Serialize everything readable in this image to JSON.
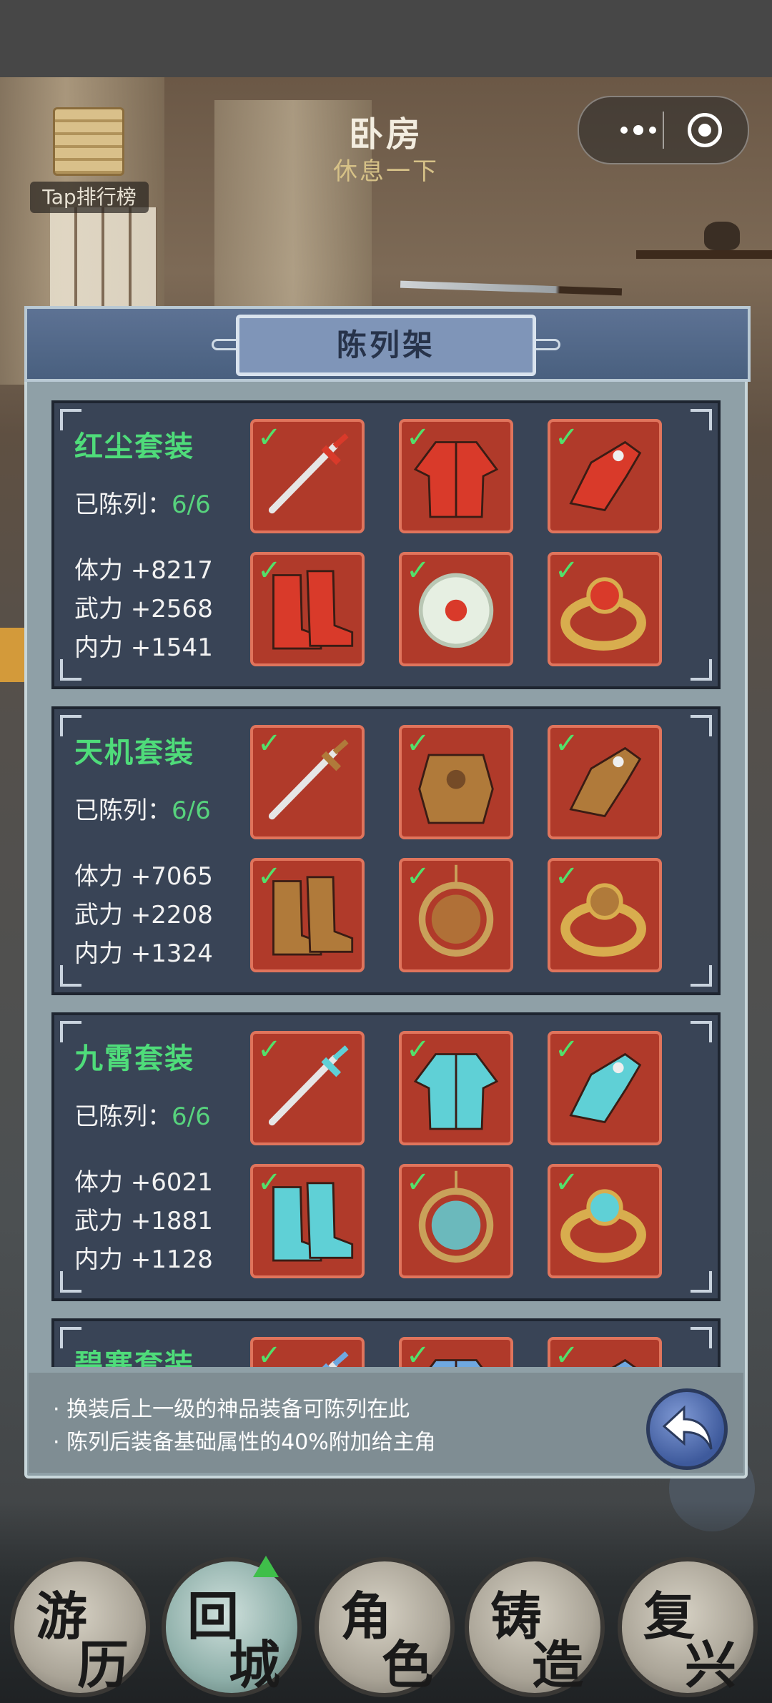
{
  "room": {
    "title": "卧房",
    "subtitle": "休息一下"
  },
  "rank": {
    "label": "Tap排行榜"
  },
  "capsule": {
    "menu_icon": "more-dots-icon",
    "close_icon": "target-icon"
  },
  "panel": {
    "title": "陈列架"
  },
  "suits": [
    {
      "name": "红尘套装",
      "count_label": "已陈列：",
      "count": "6/6",
      "stats": [
        "体力 +8217",
        "武力 +2568",
        "内力 +1541"
      ],
      "theme": "#d93a2a",
      "items": [
        "sword-icon",
        "robe-icon",
        "gauntlet-icon",
        "boots-icon",
        "jade-pendant-icon",
        "ring-icon"
      ]
    },
    {
      "name": "天机套装",
      "count_label": "已陈列：",
      "count": "6/6",
      "stats": [
        "体力 +7065",
        "武力 +2208",
        "内力 +1324"
      ],
      "theme": "#b07a3a",
      "items": [
        "sword-icon",
        "armor-icon",
        "gauntlet-icon",
        "boots-icon",
        "amulet-icon",
        "ring-icon"
      ]
    },
    {
      "name": "九霄套装",
      "count_label": "已陈列：",
      "count": "6/6",
      "stats": [
        "体力 +6021",
        "武力 +1881",
        "内力 +1128"
      ],
      "theme": "#5fd0d6",
      "items": [
        "sword-icon",
        "robe-icon",
        "gauntlet-icon",
        "boots-icon",
        "amulet-icon",
        "ring-icon"
      ]
    },
    {
      "name": "碧寒套装",
      "count_label": "",
      "count": "",
      "stats": [],
      "theme": "#6fa8e0",
      "items": [
        "sword-icon",
        "robe-icon",
        "gauntlet-icon"
      ]
    }
  ],
  "check_mark": "✓",
  "tips": [
    "· 换装后上一级的神品装备可陈列在此",
    "· 陈列后装备基础属性的40%附加给主角"
  ],
  "nav": [
    {
      "c1": "游",
      "c2": "历"
    },
    {
      "c1": "回",
      "c2": "城",
      "active": true
    },
    {
      "c1": "角",
      "c2": "色"
    },
    {
      "c1": "铸",
      "c2": "造"
    },
    {
      "c1": "复",
      "c2": "兴"
    }
  ]
}
